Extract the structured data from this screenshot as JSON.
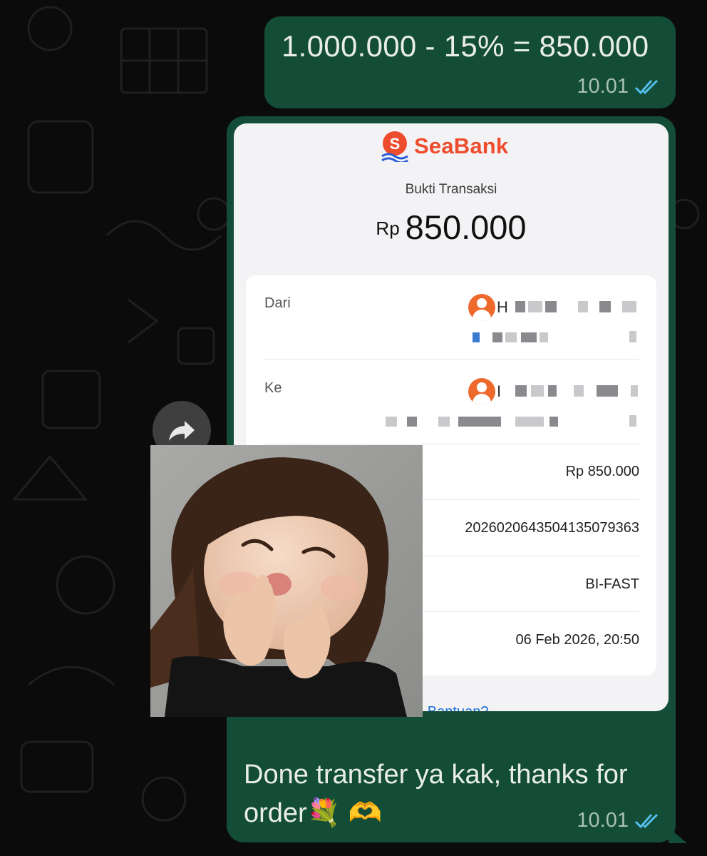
{
  "chat": {
    "message1": {
      "text": "1.000.000 - 15% = 850.000",
      "time": "10.01",
      "status_icon": "double-check-icon"
    },
    "message2": {
      "receipt": {
        "brand": "SeaBank",
        "title": "Bukti Transaksi",
        "amount_currency": "Rp",
        "amount_value": "850.000",
        "from_label": "Dari",
        "from_initial": "H",
        "to_label": "Ke",
        "to_initial": "I",
        "amount_row": "Rp 850.000",
        "reference": "20260206435041350793​63",
        "method": "BI-FAST",
        "datetime": "06 Feb 2026, 20:50",
        "help_link": "uh Bantuan?"
      },
      "caption": "Done transfer ya kak, thanks for order💐 🫶",
      "time": "10.01",
      "status_icon": "double-check-icon"
    }
  },
  "colors": {
    "bubble_out": "#144d37",
    "background": "#0b0b0b",
    "seabank_orange": "#ee4d2d",
    "read_ticks": "#53bdeb"
  }
}
